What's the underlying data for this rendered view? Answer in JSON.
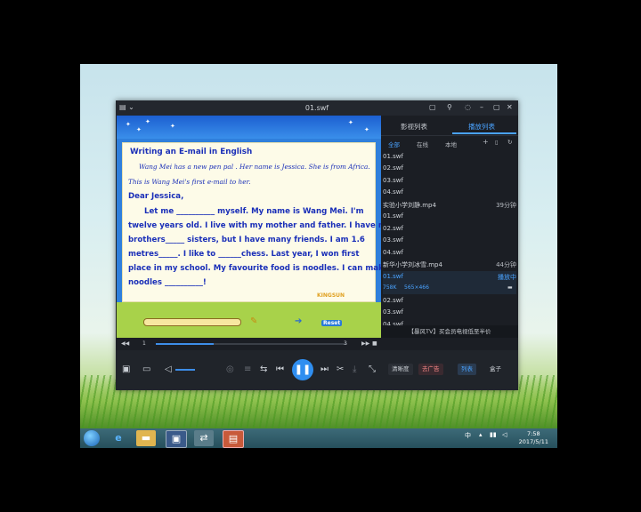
{
  "window": {
    "title": "01.swf"
  },
  "video": {
    "heading": "Writing an E-mail in English",
    "intro1": "Wang Mei has a new pen pal . Her name is Jessica. She is from Africa.",
    "intro2": "This is Wang Mei's first e-mail to her.",
    "lines": [
      "Dear Jessica,",
      "Let me __________ myself. My name is Wang Mei. I'm",
      "twelve years old. I live with my mother and father. I have no",
      "brothers_____ sisters, but I have many friends. I am 1.6",
      "metres_____. I like to ______chess. Last year, I won first",
      "place in my school. My favourite food is noodles. I can make",
      "noodles __________!"
    ],
    "brand": "KINGSUN",
    "reset_label": "Reset"
  },
  "playlist": {
    "tab_library": "影视列表",
    "tab_playlist": "播放列表",
    "sub_all": "全部",
    "sub_online": "在线",
    "sub_local": "本地",
    "items": [
      {
        "name": "01.swf",
        "dur": ""
      },
      {
        "name": "02.swf",
        "dur": ""
      },
      {
        "name": "03.swf",
        "dur": ""
      },
      {
        "name": "04.swf",
        "dur": ""
      },
      {
        "name": "实验小学刘静.mp4",
        "dur": "39分钟"
      },
      {
        "name": "01.swf",
        "dur": ""
      },
      {
        "name": "02.swf",
        "dur": ""
      },
      {
        "name": "03.swf",
        "dur": ""
      },
      {
        "name": "04.swf",
        "dur": ""
      },
      {
        "name": "新华小学刘冰雪.mp4",
        "dur": "44分钟"
      }
    ],
    "selected": {
      "name": "01.swf",
      "status": "播放中",
      "size": "758K",
      "resolution": "565×466"
    },
    "items_after": [
      {
        "name": "02.swf"
      },
      {
        "name": "03.swf"
      },
      {
        "name": "04.swf"
      }
    ],
    "ad_text": "【暴风TV】买会员电视低至半价"
  },
  "seek": {
    "current": "1",
    "total": "3",
    "progress": 0.3
  },
  "controls": {
    "quality_label": "清晰度",
    "vip_label": "去广告",
    "list_label": "列表",
    "box_label": "盒子"
  },
  "taskbar": {
    "tray_lang": "中",
    "time": "7:58",
    "date": "2017/5/11"
  }
}
